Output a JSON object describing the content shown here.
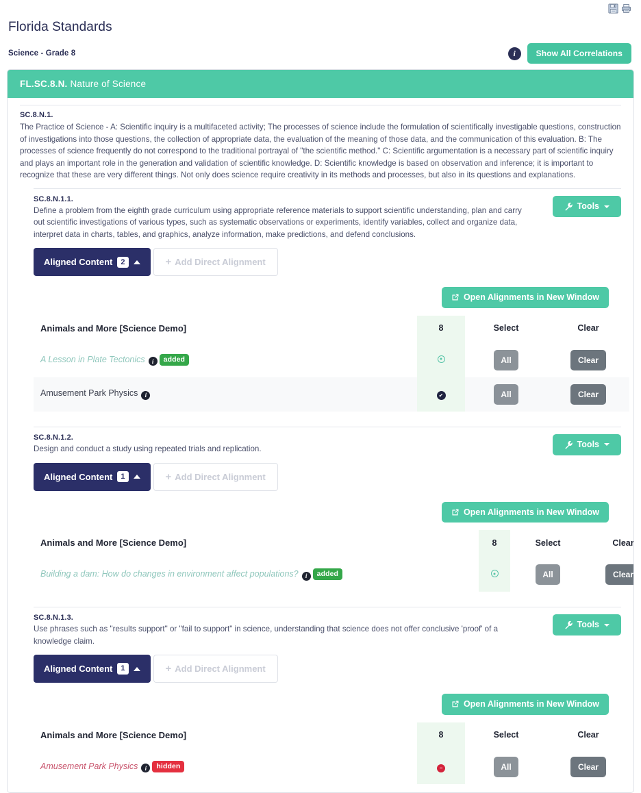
{
  "header": {
    "title": "Florida Standards",
    "subtitle": "Science - Grade 8",
    "save_icon": "save-floppy-icon",
    "print_icon": "print-icon",
    "info_icon_label": "i",
    "show_all_correlations_label": "Show All Correlations"
  },
  "card": {
    "head_code": "FL.SC.8.N.",
    "head_title": "Nature of Science"
  },
  "standard": {
    "code": "SC.8.N.1.",
    "description": "The Practice of Science - A: Scientific inquiry is a multifaceted activity; The processes of science include the formulation of scientifically investigable questions, construction of investigations into those questions, the collection of appropriate data, the evaluation of the meaning of those data, and the communication of this evaluation. B: The processes of science frequently do not correspond to the traditional portrayal of \"the scientific method.\" C: Scientific argumentation is a necessary part of scientific inquiry and plays an important role in the generation and validation of scientific knowledge. D: Scientific knowledge is based on observation and inference; it is important to recognize that these are very different things. Not only does science require creativity in its methods and processes, but also in its questions and explanations."
  },
  "labels": {
    "tools": "Tools",
    "aligned_content": "Aligned Content",
    "add_direct_alignment": "Add Direct Alignment",
    "plus": "+",
    "open_alignments": "Open Alignments in New Window",
    "select_header": "Select",
    "clear_header": "Clear",
    "all_button": "All",
    "clear_button": "Clear",
    "info_glyph": "i",
    "check_glyph": "✔",
    "hidden_glyph": "−"
  },
  "colors": {
    "teal": "#4ec9a6",
    "navy": "#2b2f68",
    "green_badge": "#34a749",
    "red_badge": "#e4303f",
    "gray_button": "#6c757d",
    "grade_column_bg": "#edf8ef"
  },
  "benchmarks": [
    {
      "code": "SC.8.N.1.1.",
      "description": "Define a problem from the eighth grade curriculum using appropriate reference materials to support scientific understanding, plan and carry out scientific investigations of various types, such as systematic observations or experiments, identify variables, collect and organize data, interpret data in charts, tables, and graphics, analyze information, make predictions, and defend conclusions.",
      "aligned_count": "2",
      "table": {
        "product_title": "Animals and More [Science Demo]",
        "grade_header": "8",
        "rows": [
          {
            "title": "A Lesson in Plate Tectonics",
            "tag": "added",
            "tag_type": "added",
            "status": "open",
            "italic": true
          },
          {
            "title": "Amusement Park Physics",
            "tag": "",
            "tag_type": "none",
            "status": "checked",
            "italic": false
          }
        ]
      }
    },
    {
      "code": "SC.8.N.1.2.",
      "description": "Design and conduct a study using repeated trials and replication.",
      "aligned_count": "1",
      "table": {
        "product_title": "Animals and More [Science Demo]",
        "grade_header": "8",
        "rows": [
          {
            "title": "Building a dam: How do changes in environment affect populations?",
            "tag": "added",
            "tag_type": "added",
            "status": "open",
            "italic": true
          }
        ]
      }
    },
    {
      "code": "SC.8.N.1.3.",
      "description": "Use phrases such as \"results support\" or \"fail to support\" in science, understanding that science does not offer conclusive 'proof' of a knowledge claim.",
      "aligned_count": "1",
      "table": {
        "product_title": "Animals and More [Science Demo]",
        "grade_header": "8",
        "rows": [
          {
            "title": "Amusement Park Physics",
            "tag": "hidden",
            "tag_type": "hidden",
            "status": "hidden",
            "italic": true
          }
        ]
      }
    }
  ]
}
